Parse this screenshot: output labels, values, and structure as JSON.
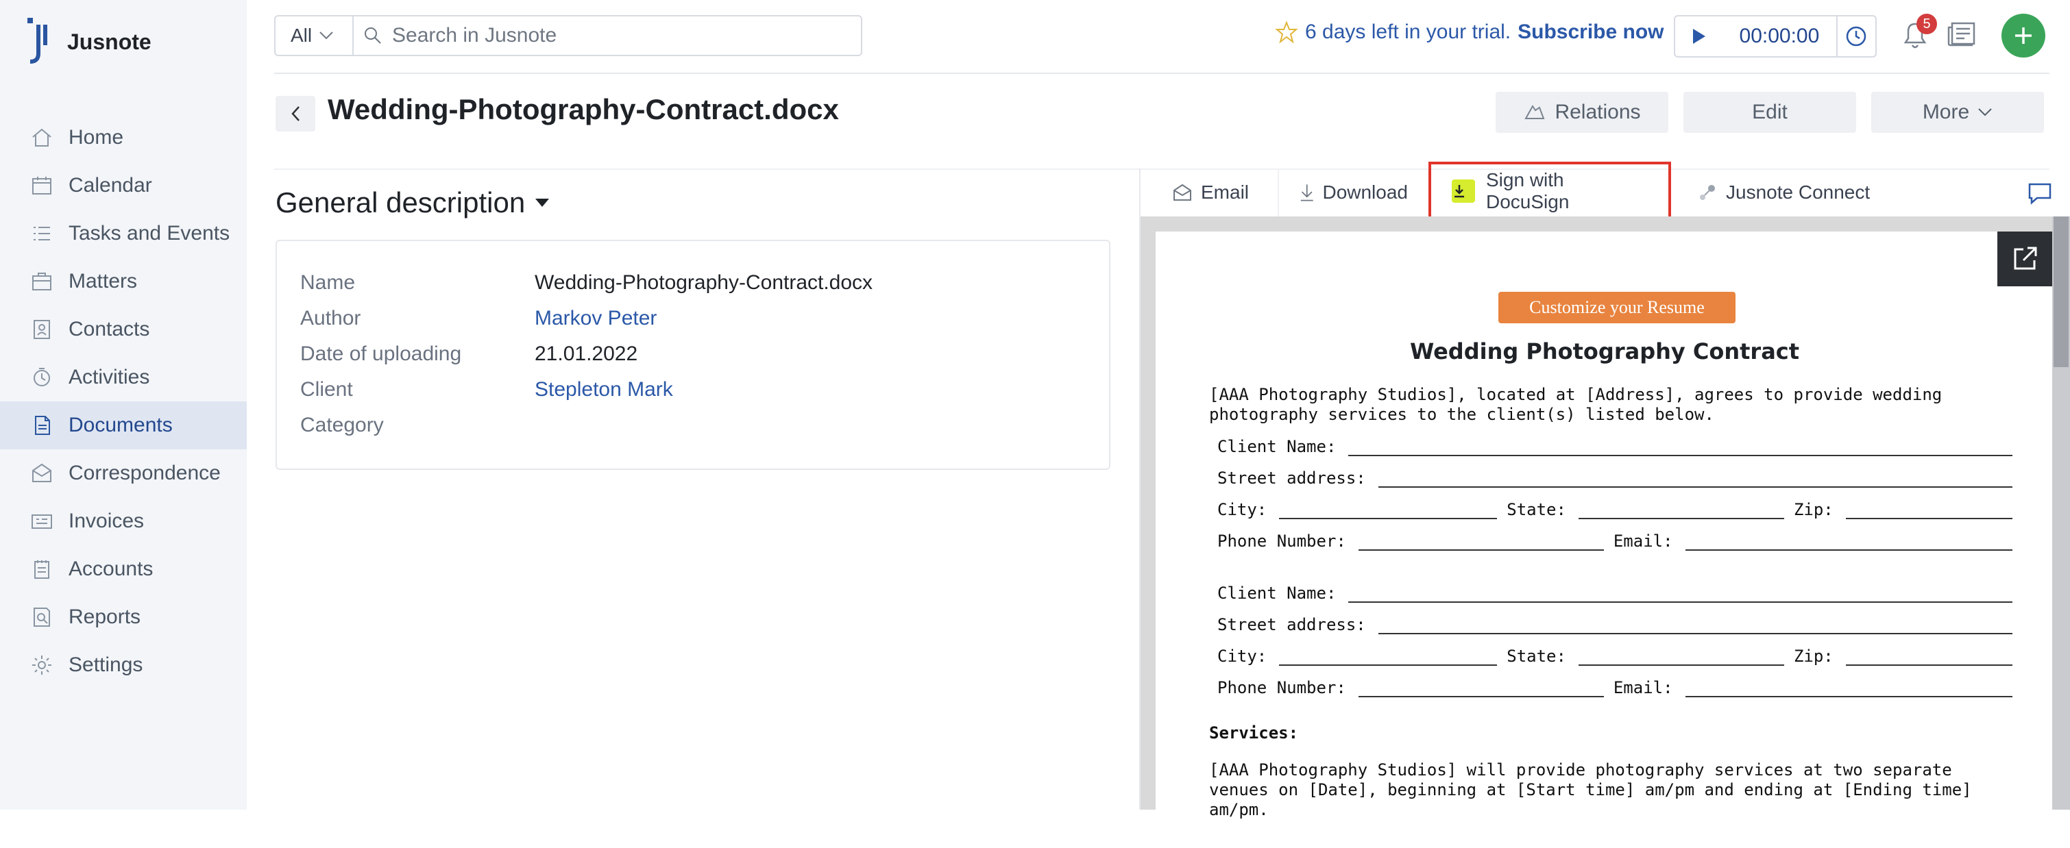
{
  "app": {
    "name": "Jusnote"
  },
  "sidebar": {
    "items": [
      {
        "label": "Home",
        "icon": "home-icon"
      },
      {
        "label": "Calendar",
        "icon": "calendar-icon"
      },
      {
        "label": "Tasks and Events",
        "icon": "tasks-icon"
      },
      {
        "label": "Matters",
        "icon": "briefcase-icon"
      },
      {
        "label": "Contacts",
        "icon": "contacts-icon"
      },
      {
        "label": "Activities",
        "icon": "activities-icon"
      },
      {
        "label": "Documents",
        "icon": "documents-icon",
        "active": true
      },
      {
        "label": "Correspondence",
        "icon": "mail-icon"
      },
      {
        "label": "Invoices",
        "icon": "invoice-icon"
      },
      {
        "label": "Accounts",
        "icon": "accounts-icon"
      },
      {
        "label": "Reports",
        "icon": "reports-icon"
      },
      {
        "label": "Settings",
        "icon": "gear-icon"
      }
    ]
  },
  "search": {
    "scope": "All",
    "placeholder": "Search in Jusnote"
  },
  "trial": {
    "text": "6 days left in your trial.",
    "link": "Subscribe now"
  },
  "timer": {
    "value": "00:00:00"
  },
  "notifications": {
    "count": "5"
  },
  "header": {
    "title": "Wedding-Photography-Contract.docx",
    "actions": {
      "relations": "Relations",
      "edit": "Edit",
      "more": "More"
    }
  },
  "general": {
    "title": "General description",
    "fields": [
      {
        "label": "Name",
        "value": "Wedding-Photography-Contract.docx"
      },
      {
        "label": "Author",
        "value": "Markov Peter"
      },
      {
        "label": "Date of uploading",
        "value": "21.01.2022"
      },
      {
        "label": "Client",
        "value": "Stepleton Mark"
      },
      {
        "label": "Category",
        "value": ""
      }
    ]
  },
  "doc_toolbar": {
    "email": "Email",
    "download": "Download",
    "docusign": "Sign with DocuSign",
    "connect": "Jusnote Connect"
  },
  "document": {
    "cta": "Customize your Resume",
    "title": "Wedding Photography Contract",
    "intro": "[AAA Photography Studios], located at [Address], agrees to provide wedding photography services to the client(s) listed below.",
    "labels": {
      "client_name": "Client Name:",
      "street": "Street address:",
      "city": "City:",
      "state": "State:",
      "zip": "Zip:",
      "phone": "Phone Number:",
      "email": "Email:"
    },
    "services_heading": "Services:",
    "services_text": "[AAA Photography Studios] will provide photography services at two separate venues on [Date], beginning at [Start time] am/pm and ending at [Ending time] am/pm."
  }
}
